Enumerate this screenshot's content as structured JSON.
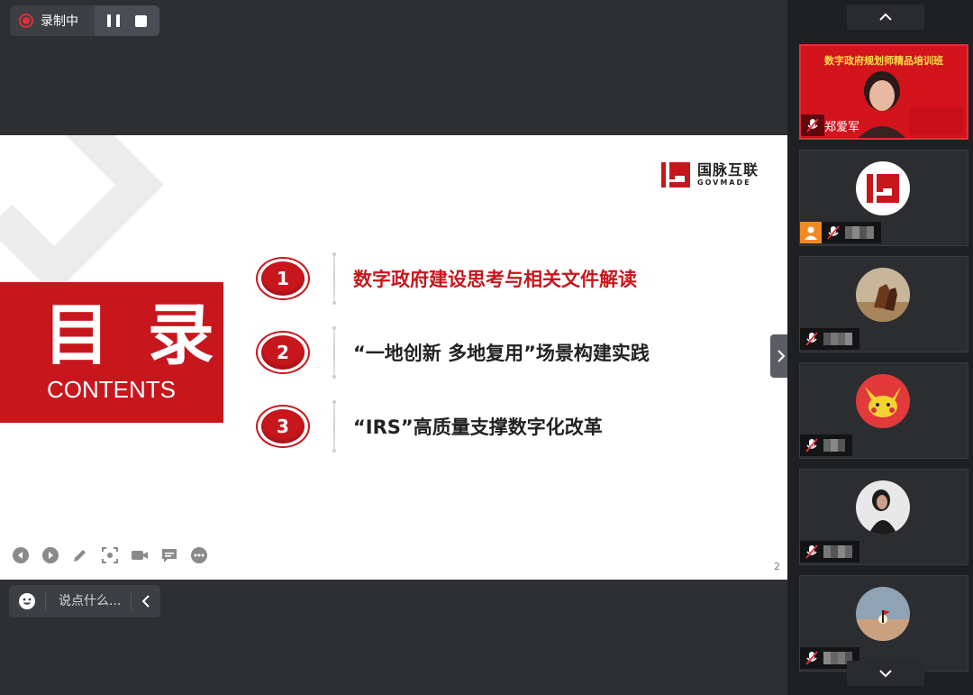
{
  "recording": {
    "status_label": "录制中",
    "controls": [
      "pause",
      "stop"
    ]
  },
  "slide": {
    "logo": {
      "name_cn": "国脉互联",
      "name_en": "GOVMADE"
    },
    "title_cn": "目 录",
    "title_en": "CONTENTS",
    "toc": [
      {
        "number": "1",
        "text": "数字政府建设思考与相关文件解读",
        "active": true
      },
      {
        "number": "2",
        "text": "“一地创新 多地复用”场景构建实践",
        "active": false
      },
      {
        "number": "3",
        "text": "“IRS”高质量支撑数字化改革",
        "active": false
      }
    ],
    "page_number": "2",
    "tools": [
      "prev-icon",
      "next-icon",
      "pen-icon",
      "screenshot-icon",
      "camera-icon",
      "comment-icon",
      "more-icon"
    ],
    "accent_color": "#c8161d"
  },
  "chat": {
    "placeholder": "说点什么..."
  },
  "participants": {
    "speaker": {
      "banner": "数字政府规划师精品培训班",
      "name": "郑爱军"
    },
    "tiles": [
      {
        "avatar": "govmade-logo-avatar",
        "role_icon": "person-icon"
      },
      {
        "avatar": "horse-avatar"
      },
      {
        "avatar": "pikachu-avatar"
      },
      {
        "avatar": "portrait-avatar"
      },
      {
        "avatar": "sunset-avatar"
      }
    ]
  }
}
